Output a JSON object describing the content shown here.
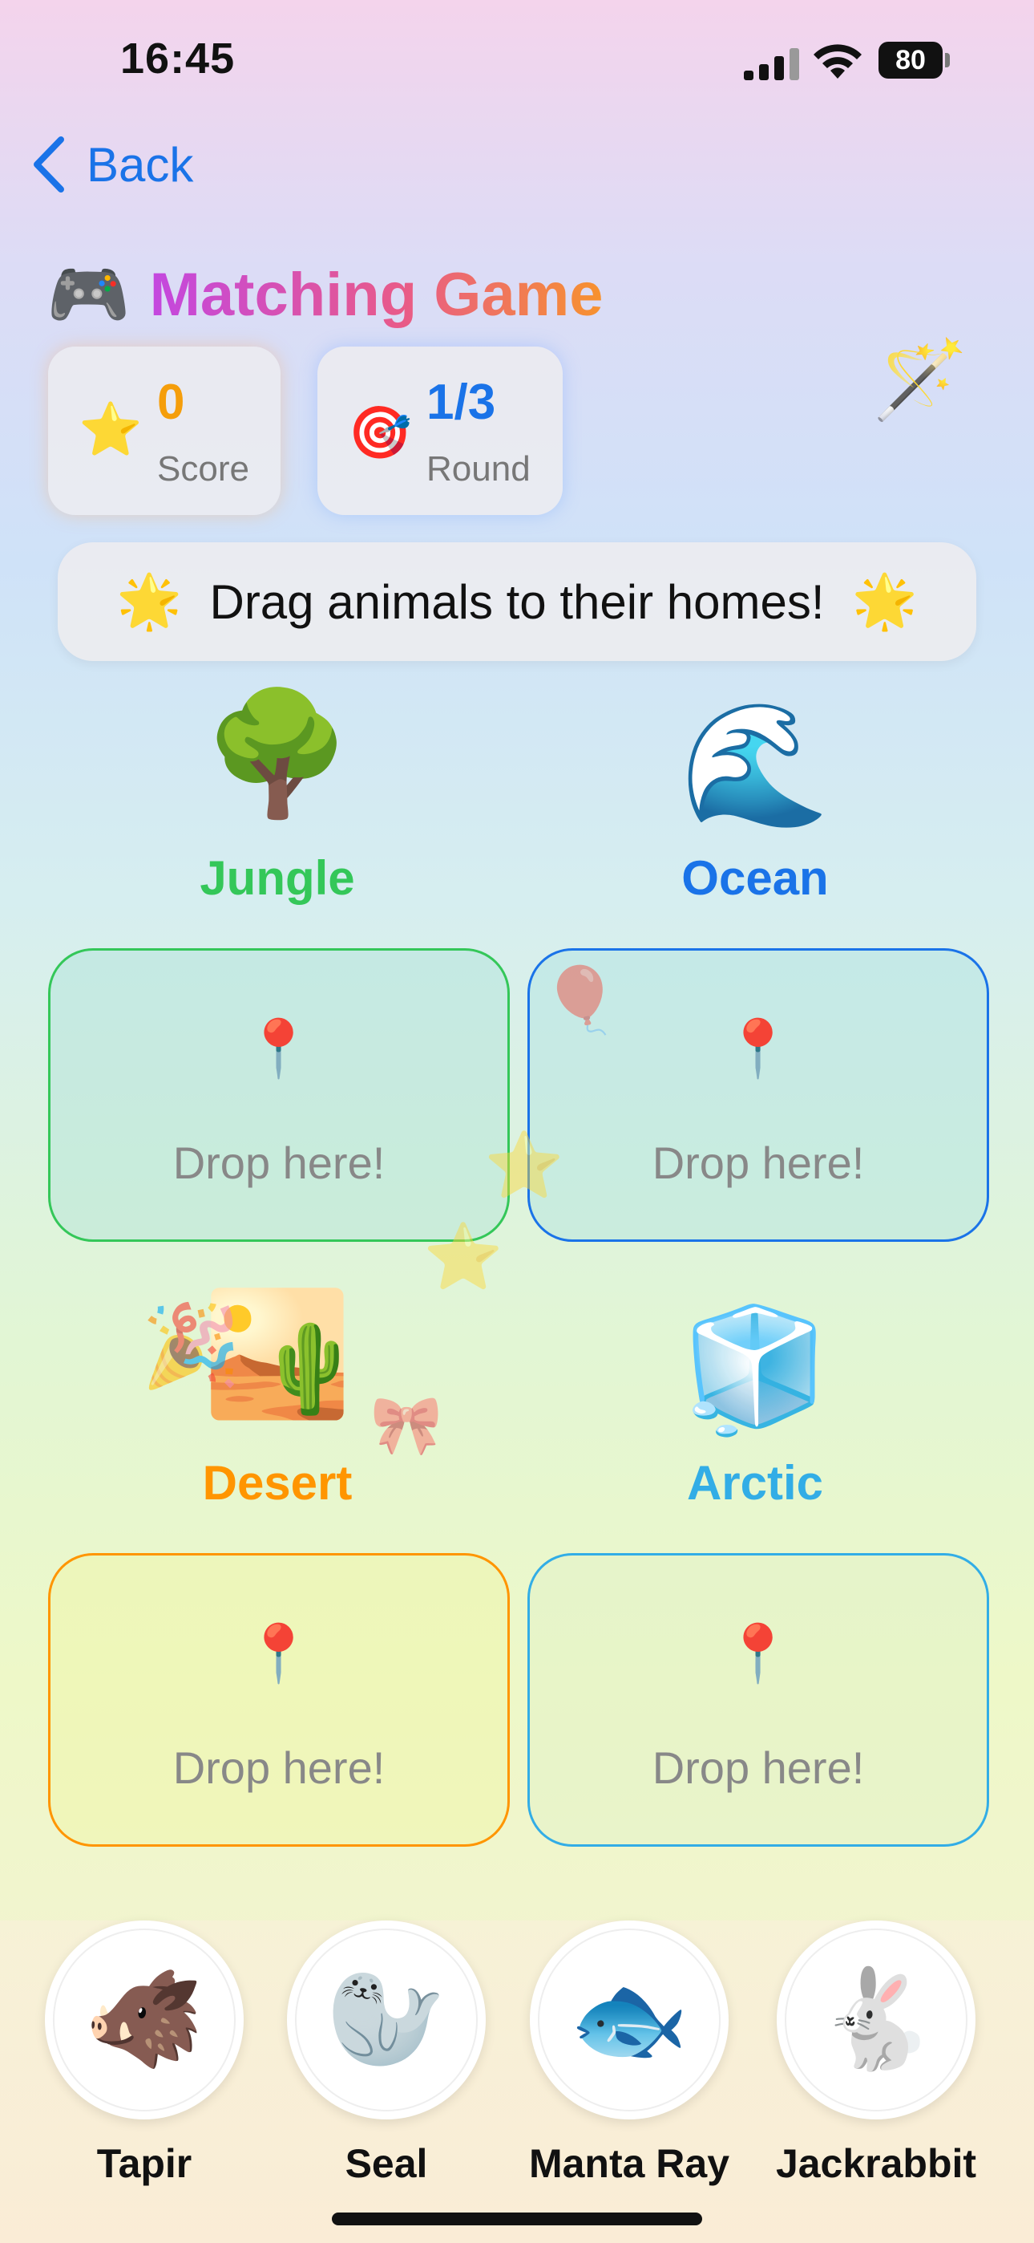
{
  "status_bar": {
    "time": "16:45",
    "battery": "80"
  },
  "nav": {
    "back_label": "Back"
  },
  "header": {
    "icon": "🎮",
    "title": "Matching Game",
    "wand_icon": "🪄"
  },
  "stats": {
    "score": {
      "icon": "⭐",
      "value": "0",
      "label": "Score",
      "color": "#f59e0b"
    },
    "round": {
      "icon": "🎯",
      "value": "1/3",
      "label": "Round",
      "color": "#1a73e8"
    }
  },
  "instruction": {
    "text": "Drag animals to their homes!",
    "star_icon": "🌟"
  },
  "habitats": [
    {
      "name": "Jungle",
      "icon": "🌳",
      "color": "#34c759",
      "drop_text": "Drop here!",
      "pin_icon": "📍"
    },
    {
      "name": "Ocean",
      "icon": "🌊",
      "color": "#1a73e8",
      "drop_text": "Drop here!",
      "pin_icon": "📍"
    },
    {
      "name": "Desert",
      "icon": "🏜️",
      "color": "#ff9500",
      "drop_text": "Drop here!",
      "pin_icon": "📍"
    },
    {
      "name": "Arctic",
      "icon": "🧊",
      "color": "#32ade6",
      "drop_text": "Drop here!",
      "pin_icon": "📍"
    }
  ],
  "decorations": [
    "🎈",
    "⭐",
    "⭐",
    "🎉",
    "🎀"
  ],
  "animals": [
    {
      "name": "Tapir",
      "icon": "🐗"
    },
    {
      "name": "Seal",
      "icon": "🦭"
    },
    {
      "name": "Manta Ray",
      "icon": "🐟"
    },
    {
      "name": "Jackrabbit",
      "icon": "🐇"
    }
  ]
}
